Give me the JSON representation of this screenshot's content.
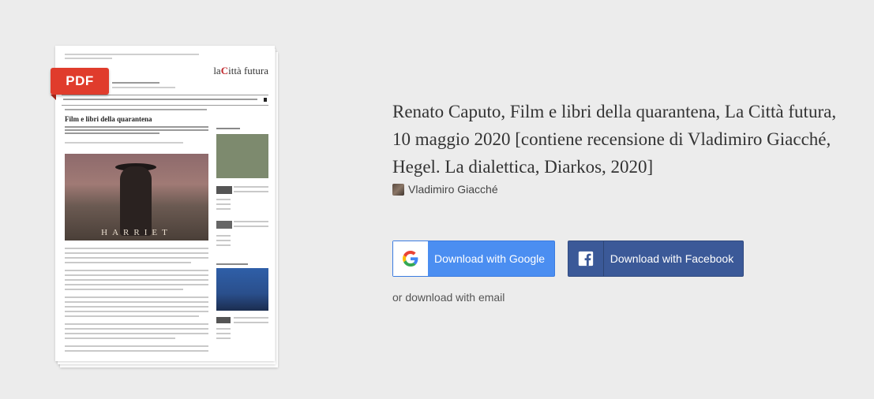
{
  "document": {
    "badge": "PDF",
    "preview_logo_prefix": "la",
    "preview_logo_mark": "C",
    "preview_logo_suffix": "ittà futura",
    "preview_headline": "Film e libri della quarantena",
    "preview_photo_caption": "HARRIET"
  },
  "info": {
    "title": "Renato Caputo, Film e libri della quarantena, La Città futura, 10 maggio 2020 [contiene recensione di Vladimiro Giacché, Hegel. La dialettica, Diarkos, 2020]",
    "author": "Vladimiro Giacché"
  },
  "actions": {
    "google_label": "Download with Google",
    "facebook_label": "Download with Facebook",
    "email_label": "or download with email"
  },
  "colors": {
    "google_button": "#4b8ef1",
    "facebook_button": "#3b5998",
    "pdf_badge": "#e03c2c"
  }
}
